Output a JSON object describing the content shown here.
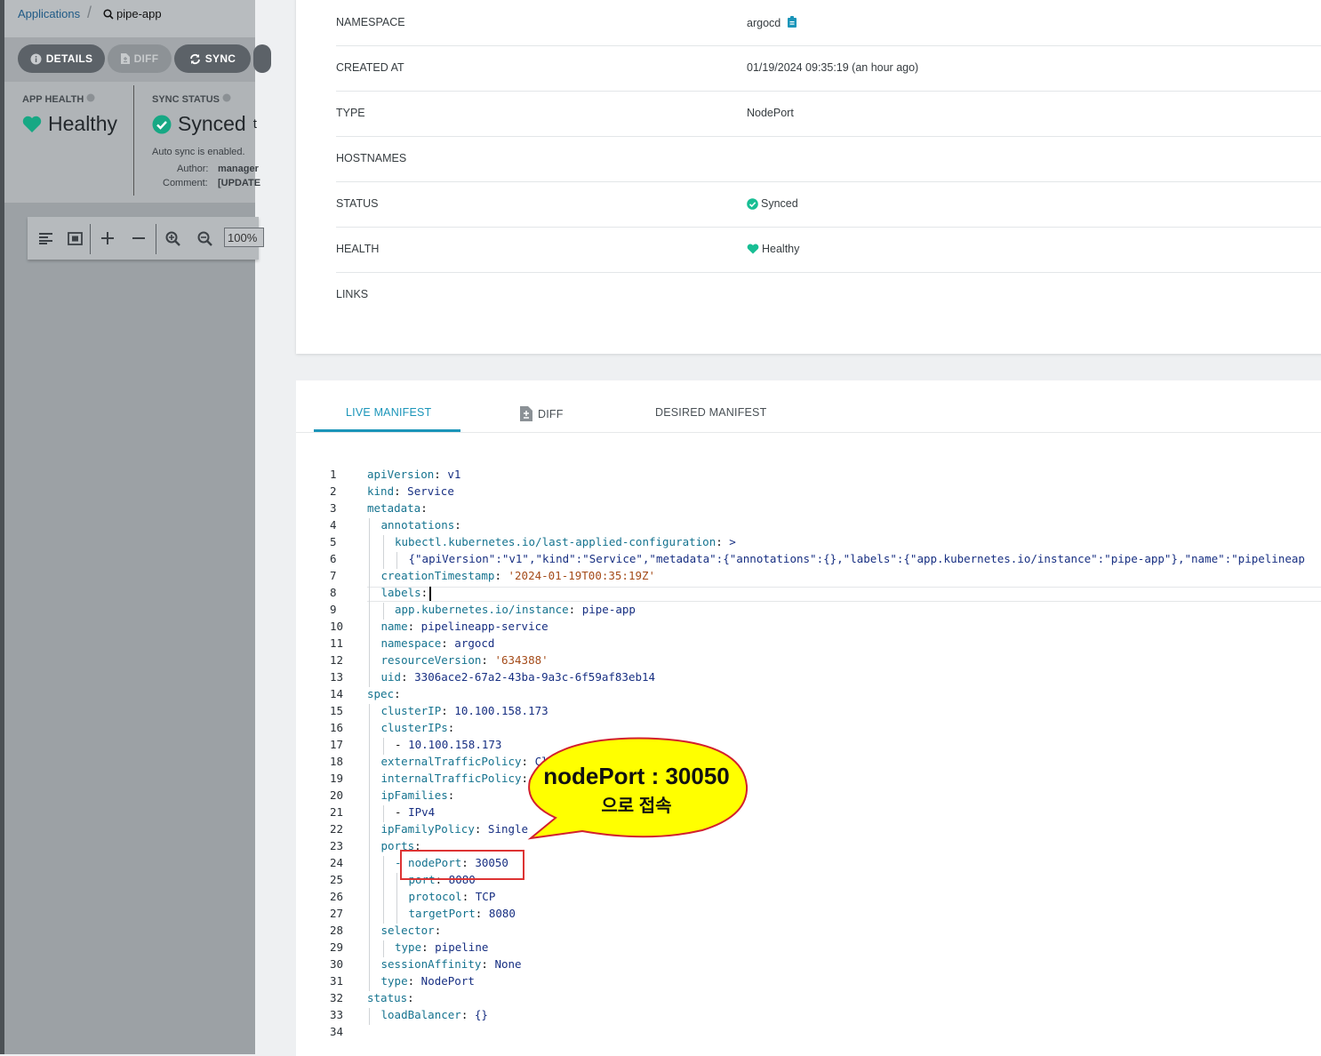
{
  "breadcrumb": {
    "applications": "Applications",
    "app_name": "pipe-app"
  },
  "toolbar_buttons": {
    "details": "DETAILS",
    "diff": "DIFF",
    "sync": "SYNC"
  },
  "status_panel": {
    "app_health_title": "APP HEALTH",
    "app_health_value": "Healthy",
    "sync_status_title": "SYNC STATUS",
    "sync_status_value": "Synced",
    "sync_status_trail": "t",
    "auto_sync": "Auto sync is enabled.",
    "author_label": "Author:",
    "author_value": "manager",
    "comment_label": "Comment:",
    "comment_value": "[UPDATE"
  },
  "graph_toolbar": {
    "zoom": "100%"
  },
  "summary": {
    "rows": [
      {
        "key": "NAMESPACE",
        "value": "argocd"
      },
      {
        "key": "CREATED AT",
        "value": "01/19/2024 09:35:19  (an hour ago)"
      },
      {
        "key": "TYPE",
        "value": "NodePort"
      },
      {
        "key": "HOSTNAMES",
        "value": ""
      },
      {
        "key": "STATUS",
        "value": "Synced"
      },
      {
        "key": "HEALTH",
        "value": "Healthy"
      },
      {
        "key": "LINKS",
        "value": ""
      }
    ]
  },
  "manifest_tabs": {
    "live": "LIVE MANIFEST",
    "diff": "DIFF",
    "desired": "DESIRED MANIFEST"
  },
  "manifest": {
    "lines": [
      {
        "n": "1",
        "i": 0,
        "k": "apiVersion",
        "v": "v1"
      },
      {
        "n": "2",
        "i": 0,
        "k": "kind",
        "v": "Service"
      },
      {
        "n": "3",
        "i": 0,
        "k": "metadata",
        "v": ""
      },
      {
        "n": "4",
        "i": 1,
        "k": "annotations",
        "v": ""
      },
      {
        "n": "5",
        "i": 2,
        "k": "kubectl.kubernetes.io/last-applied-configuration",
        "v": ">"
      },
      {
        "n": "6",
        "i": 3,
        "k": "",
        "v": "{\"apiVersion\":\"v1\",\"kind\":\"Service\",\"metadata\":{\"annotations\":{},\"labels\":{\"app.kubernetes.io/instance\":\"pipe-app\"},\"name\":\"pipelineap"
      },
      {
        "n": "7",
        "i": 1,
        "k": "creationTimestamp",
        "v": "'2024-01-19T00:35:19Z'"
      },
      {
        "n": "8",
        "i": 1,
        "k": "labels",
        "v": ""
      },
      {
        "n": "9",
        "i": 2,
        "k": "app.kubernetes.io/instance",
        "v": "pipe-app"
      },
      {
        "n": "10",
        "i": 1,
        "k": "name",
        "v": "pipelineapp-service"
      },
      {
        "n": "11",
        "i": 1,
        "k": "namespace",
        "v": "argocd"
      },
      {
        "n": "12",
        "i": 1,
        "k": "resourceVersion",
        "v": "'634388'"
      },
      {
        "n": "13",
        "i": 1,
        "k": "uid",
        "v": "3306ace2-67a2-43ba-9a3c-6f59af83eb14"
      },
      {
        "n": "14",
        "i": 0,
        "k": "spec",
        "v": ""
      },
      {
        "n": "15",
        "i": 1,
        "k": "clusterIP",
        "v": "10.100.158.173"
      },
      {
        "n": "16",
        "i": 1,
        "k": "clusterIPs",
        "v": ""
      },
      {
        "n": "17",
        "i": 2,
        "k": "- ",
        "v": "10.100.158.173",
        "dash": true
      },
      {
        "n": "18",
        "i": 1,
        "k": "externalTrafficPolicy",
        "v": "Cl"
      },
      {
        "n": "19",
        "i": 1,
        "k": "internalTrafficPolicy",
        "v": ""
      },
      {
        "n": "20",
        "i": 1,
        "k": "ipFamilies",
        "v": ""
      },
      {
        "n": "21",
        "i": 2,
        "k": "- ",
        "v": "IPv4",
        "dash": true
      },
      {
        "n": "22",
        "i": 1,
        "k": "ipFamilyPolicy",
        "v": "Single"
      },
      {
        "n": "23",
        "i": 1,
        "k": "ports",
        "v": ""
      },
      {
        "n": "24",
        "i": 2,
        "k": "- nodePort",
        "v": "30050"
      },
      {
        "n": "25",
        "i": 3,
        "k": "port",
        "v": "8080"
      },
      {
        "n": "26",
        "i": 3,
        "k": "protocol",
        "v": "TCP"
      },
      {
        "n": "27",
        "i": 3,
        "k": "targetPort",
        "v": "8080"
      },
      {
        "n": "28",
        "i": 1,
        "k": "selector",
        "v": ""
      },
      {
        "n": "29",
        "i": 2,
        "k": "type",
        "v": "pipeline"
      },
      {
        "n": "30",
        "i": 1,
        "k": "sessionAffinity",
        "v": "None"
      },
      {
        "n": "31",
        "i": 1,
        "k": "type",
        "v": "NodePort"
      },
      {
        "n": "32",
        "i": 0,
        "k": "status",
        "v": ""
      },
      {
        "n": "33",
        "i": 1,
        "k": "loadBalancer",
        "v": "{}"
      },
      {
        "n": "34",
        "i": 0,
        "k": "",
        "v": ""
      }
    ]
  },
  "annotation": {
    "line1": "nodePort : 30050",
    "line2": "으로 접속"
  },
  "colors": {
    "accent": "#1b95b9",
    "healthy": "#18be94",
    "callout_fill": "#ffff00",
    "callout_border": "#d2202e"
  }
}
